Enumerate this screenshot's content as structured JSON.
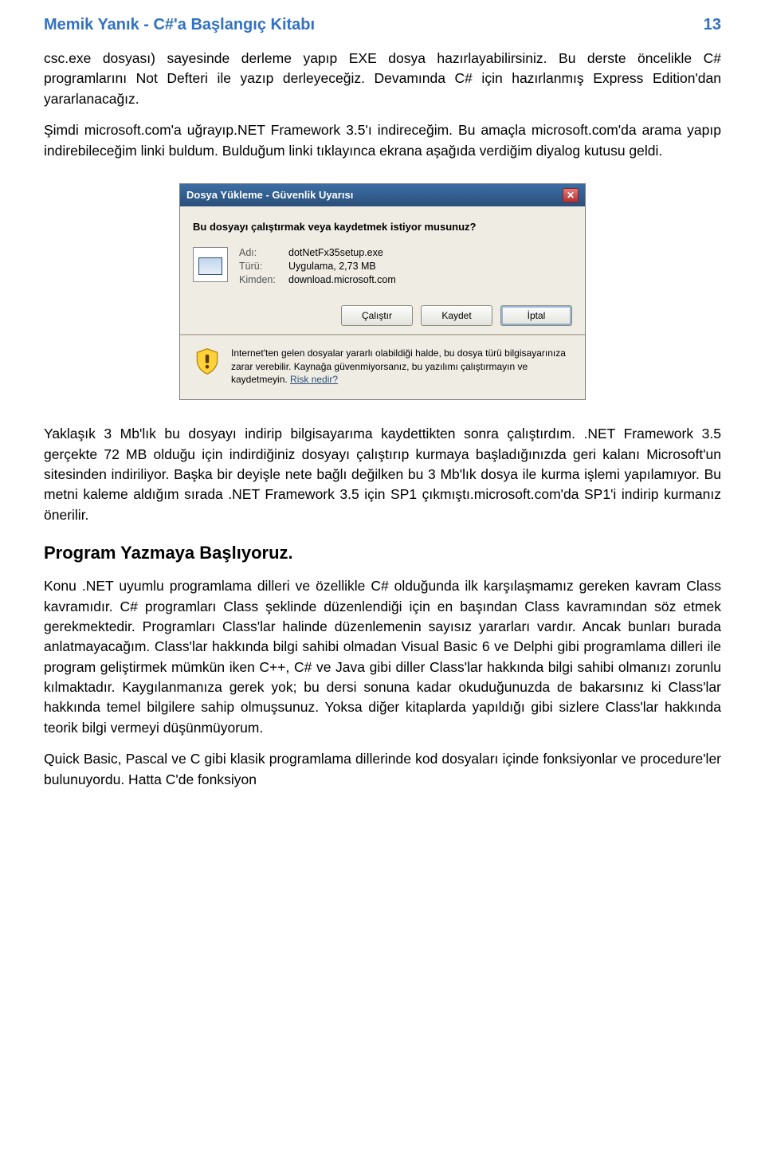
{
  "header": {
    "title": "Memik Yanık - C#'a Başlangıç Kitabı",
    "page": "13"
  },
  "paragraphs": {
    "p1": "csc.exe dosyası) sayesinde derleme yapıp EXE dosya hazırlayabilirsiniz. Bu derste öncelikle C# programlarını Not Defteri ile yazıp derleyeceğiz. Devamında C# için hazırlanmış Express Edition'dan yararlanacağız.",
    "p2": "Şimdi microsoft.com'a uğrayıp.NET Framework 3.5'ı indireceğim. Bu amaçla microsoft.com'da arama yapıp indirebileceğim linki buldum. Bulduğum linki tıklayınca ekrana aşağıda verdiğim diyalog kutusu geldi.",
    "p3": "Yaklaşık 3 Mb'lık bu dosyayı indirip bilgisayarıma kaydettikten sonra çalıştırdım. .NET Framework 3.5 gerçekte 72 MB olduğu için indirdiğiniz dosyayı çalıştırıp kurmaya başladığınızda geri kalanı Microsoft'un sitesinden indiriliyor. Başka bir deyişle nete bağlı değilken bu 3 Mb'lık dosya ile kurma işlemi yapılamıyor. Bu metni kaleme aldığım sırada .NET Framework 3.5 için SP1 çıkmıştı.microsoft.com'da SP1'i indirip kurmanız önerilir.",
    "p4": "Konu .NET uyumlu programlama dilleri ve özellikle C# olduğunda ilk karşılaşmamız gereken kavram Class kavramıdır. C# programları Class şeklinde düzenlendiği için en başından Class kavramından söz etmek gerekmektedir. Programları Class'lar halinde düzenlemenin sayısız yararları vardır. Ancak bunları burada anlatmayacağım. Class'lar hakkında bilgi sahibi olmadan Visual Basic 6 ve Delphi gibi programlama dilleri ile program geliştirmek mümkün iken C++, C# ve Java gibi diller Class'lar hakkında bilgi sahibi olmanızı zorunlu kılmaktadır. Kaygılanmanıza gerek yok; bu dersi sonuna kadar okuduğunuzda de bakarsınız ki Class'lar hakkında temel bilgilere sahip olmuşsunuz. Yoksa diğer kitaplarda yapıldığı gibi sizlere Class'lar hakkında teorik bilgi vermeyi düşünmüyorum.",
    "p5": "Quick Basic, Pascal ve C gibi klasik programlama dillerinde kod dosyaları içinde fonksiyonlar ve procedure'ler bulunuyordu. Hatta C'de fonksiyon"
  },
  "section_heading": "Program Yazmaya Başlıyoruz.",
  "dialog": {
    "title": "Dosya Yükleme - Güvenlik Uyarısı",
    "question": "Bu dosyayı çalıştırmak veya kaydetmek istiyor musunuz?",
    "meta": {
      "name_label": "Adı:",
      "name_value": "dotNetFx35setup.exe",
      "type_label": "Türü:",
      "type_value": "Uygulama, 2,73 MB",
      "from_label": "Kimden:",
      "from_value": "download.microsoft.com"
    },
    "buttons": {
      "run": "Çalıştır",
      "save": "Kaydet",
      "cancel": "İptal"
    },
    "warning": "Internet'ten gelen dosyalar yararlı olabildiği halde, bu dosya türü bilgisayarınıza zarar verebilir. Kaynağa güvenmiyorsanız, bu yazılımı çalıştırmayın ve kaydetmeyin.",
    "risk_link": "Risk nedir?"
  }
}
